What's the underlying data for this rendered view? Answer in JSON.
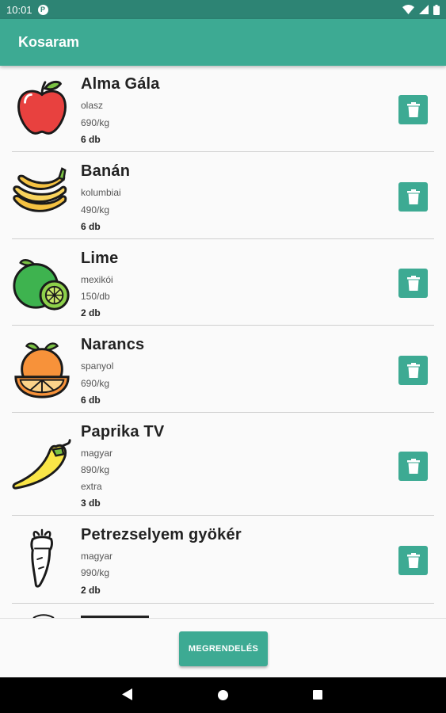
{
  "status_bar": {
    "time": "10:01",
    "notification": "P"
  },
  "app_bar": {
    "title": "Kosaram"
  },
  "items": [
    {
      "name": "Alma Gála",
      "origin": "olasz",
      "price": "690/kg",
      "qty": "6 db",
      "icon": "apple-icon"
    },
    {
      "name": "Banán",
      "origin": "kolumbiai",
      "price": "490/kg",
      "qty": "6 db",
      "icon": "banana-icon"
    },
    {
      "name": "Lime",
      "origin": "mexikói",
      "price": "150/db",
      "qty": "2 db",
      "icon": "lime-icon"
    },
    {
      "name": "Narancs",
      "origin": "spanyol",
      "price": "690/kg",
      "qty": "6 db",
      "icon": "orange-icon"
    },
    {
      "name": "Paprika TV",
      "origin": "magyar",
      "price": "890/kg",
      "extra": "extra",
      "qty": "3 db",
      "icon": "pepper-icon"
    },
    {
      "name": "Petrezselyem gyökér",
      "origin": "magyar",
      "price": "990/kg",
      "qty": "2 db",
      "icon": "parsley-root-icon"
    }
  ],
  "order_button": {
    "label": "MEGRENDELÉS"
  },
  "colors": {
    "primary": "#3daa93",
    "primary_dark": "#2d8474"
  }
}
